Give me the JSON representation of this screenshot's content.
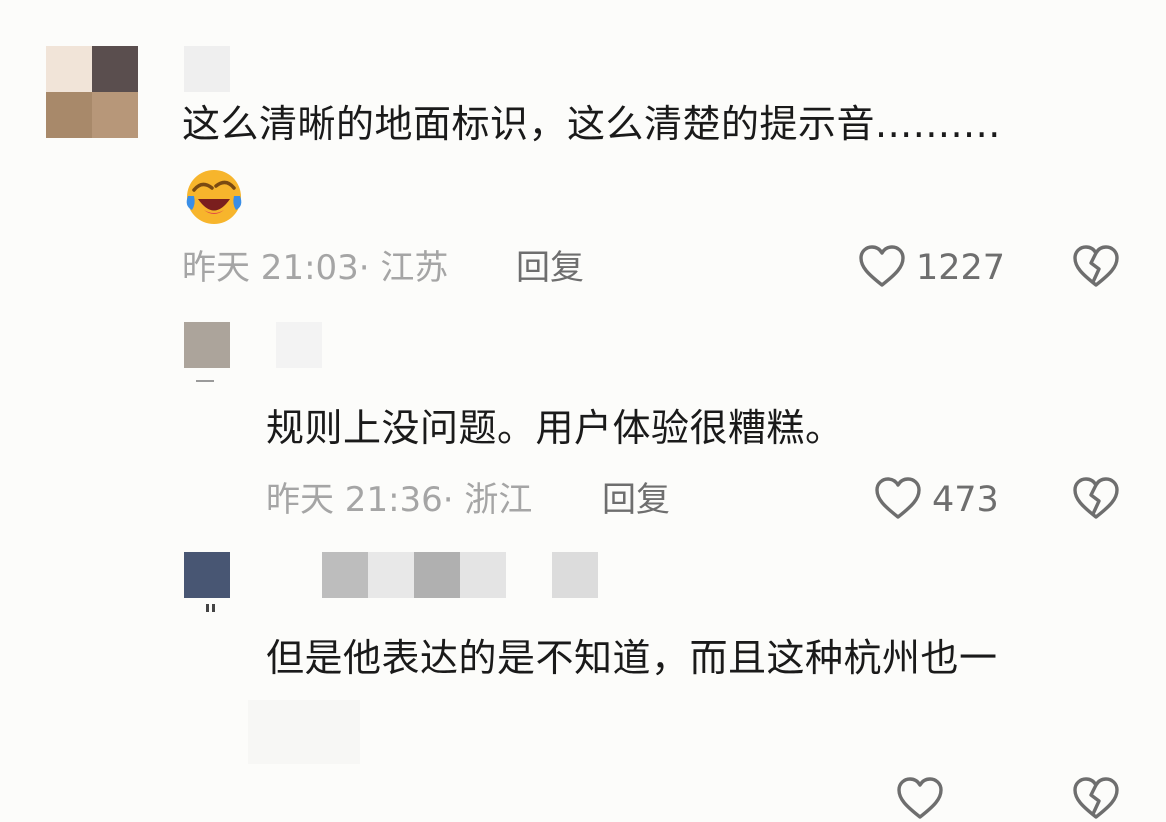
{
  "comments": [
    {
      "text_line1": "这么清晰的地面标识，这么清楚的提示音..........",
      "emoji": "face-with-tears-of-joy",
      "time": "昨天 21:03·",
      "location": "江苏",
      "reply_label": "回复",
      "likes": "1227"
    },
    {
      "text": "规则上没问题。用户体验很糟糕。",
      "time": "昨天 21:36·",
      "location": "浙江",
      "reply_label": "回复",
      "likes": "473"
    },
    {
      "text": "但是他表达的是不知道，而且这种杭州也一"
    }
  ],
  "icons": {
    "like": "heart-outline-icon",
    "dislike": "broken-heart-icon"
  },
  "colors": {
    "background": "#fcfcfa",
    "text": "#1a1a1a",
    "meta": "#a5a5a5",
    "action": "#6e6e6e"
  }
}
